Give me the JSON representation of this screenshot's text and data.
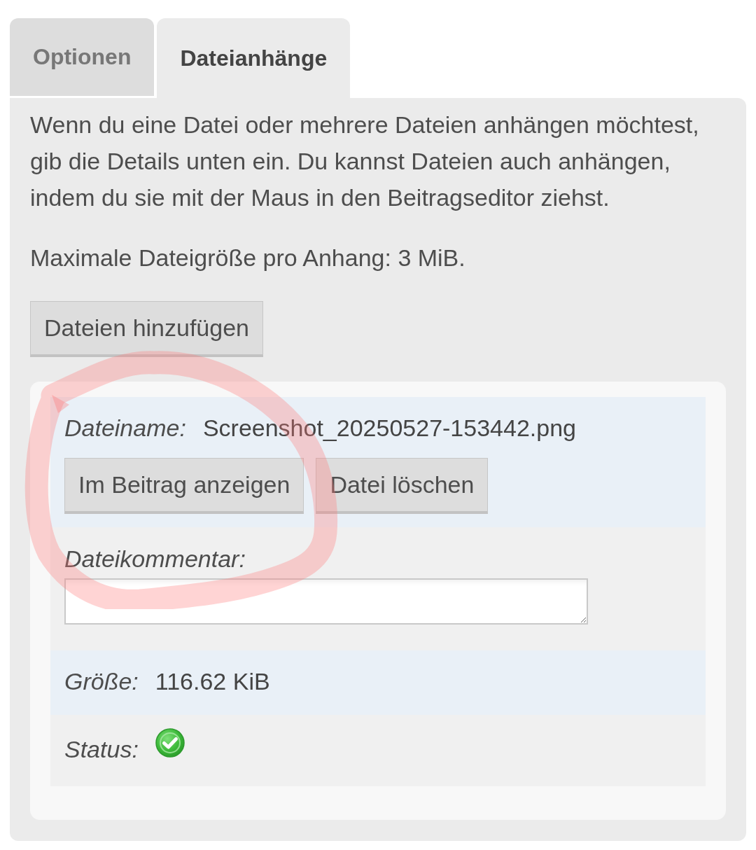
{
  "tabs": [
    {
      "label": "Optionen",
      "selected": false
    },
    {
      "label": "Dateianhänge",
      "selected": true
    }
  ],
  "intro": "Wenn du eine Datei oder mehrere Dateien anhängen möchtest,\ngib die Details unten ein. Du kannst Dateien auch anhängen,\nindem du sie mit der Maus in den Beitragseditor ziehst.",
  "max_size": "Maximale Dateigröße pro Anhang: 3 MiB.",
  "add_button": "Dateien hinzufügen",
  "attachment": {
    "filename_label": "Dateiname:",
    "filename": "Screenshot_20250527-153442.png",
    "buttons": [
      "Im Beitrag anzeigen",
      "Datei löschen"
    ],
    "comment_label": "Dateikommentar:",
    "size_label": "Größe:",
    "size": "116.62 KiB",
    "status_label": "Status:",
    "succeeded": true
  },
  "pen_marks": [
    {
      "kind": "loop"
    }
  ]
}
